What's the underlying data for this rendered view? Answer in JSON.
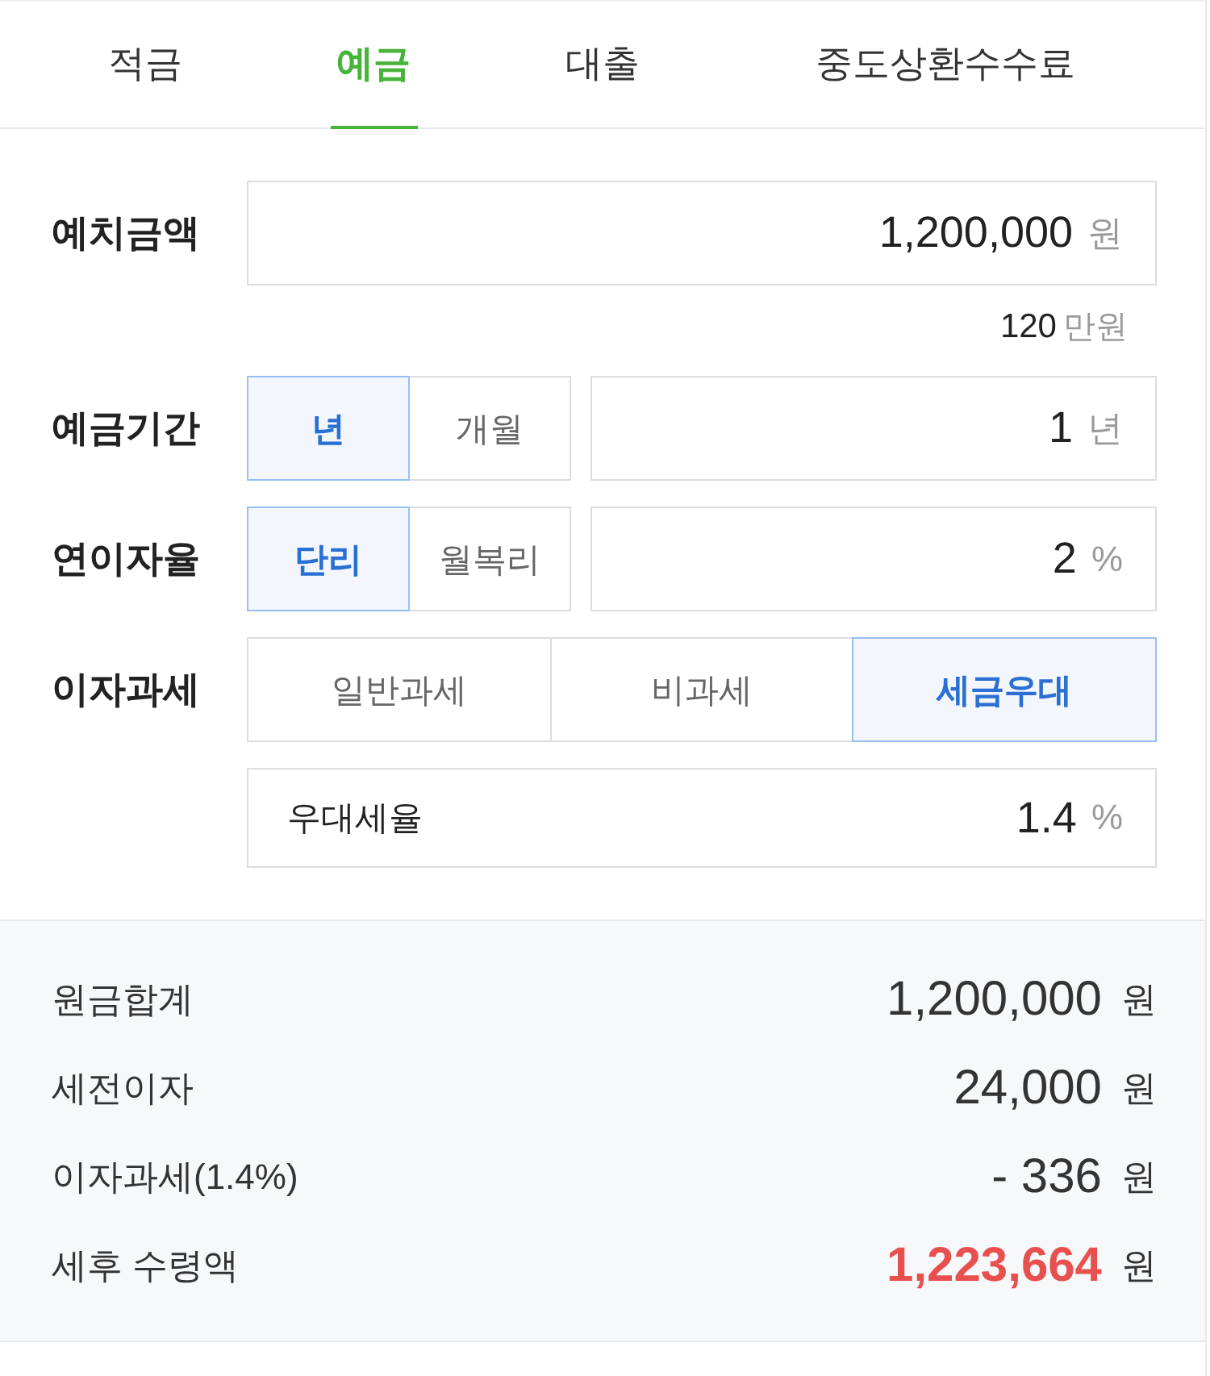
{
  "tabs": [
    {
      "label": "적금",
      "selected": false
    },
    {
      "label": "예금",
      "selected": true
    },
    {
      "label": "대출",
      "selected": false
    },
    {
      "label": "중도상환수수료",
      "selected": false
    }
  ],
  "form": {
    "deposit_amount": {
      "label": "예치금액",
      "value": "1,200,000",
      "unit": "원",
      "hint_value": "120",
      "hint_unit": "만원"
    },
    "period": {
      "label": "예금기간",
      "options": [
        {
          "label": "년",
          "selected": true
        },
        {
          "label": "개월",
          "selected": false
        }
      ],
      "value": "1",
      "unit": "년"
    },
    "interest_rate": {
      "label": "연이자율",
      "options": [
        {
          "label": "단리",
          "selected": true
        },
        {
          "label": "월복리",
          "selected": false
        }
      ],
      "value": "2",
      "unit": "%"
    },
    "taxation": {
      "label": "이자과세",
      "options": [
        {
          "label": "일반과세",
          "selected": false
        },
        {
          "label": "비과세",
          "selected": false
        },
        {
          "label": "세금우대",
          "selected": true
        }
      ],
      "preferential_rate": {
        "label": "우대세율",
        "value": "1.4",
        "unit": "%"
      }
    }
  },
  "results": [
    {
      "label": "원금합계",
      "value": "1,200,000",
      "unit": "원",
      "highlight": false
    },
    {
      "label": "세전이자",
      "value": "24,000",
      "unit": "원",
      "highlight": false
    },
    {
      "label": "이자과세(1.4%)",
      "value": "- 336",
      "unit": "원",
      "highlight": false
    },
    {
      "label": "세후 수령액",
      "value": "1,223,664",
      "unit": "원",
      "highlight": true
    }
  ]
}
